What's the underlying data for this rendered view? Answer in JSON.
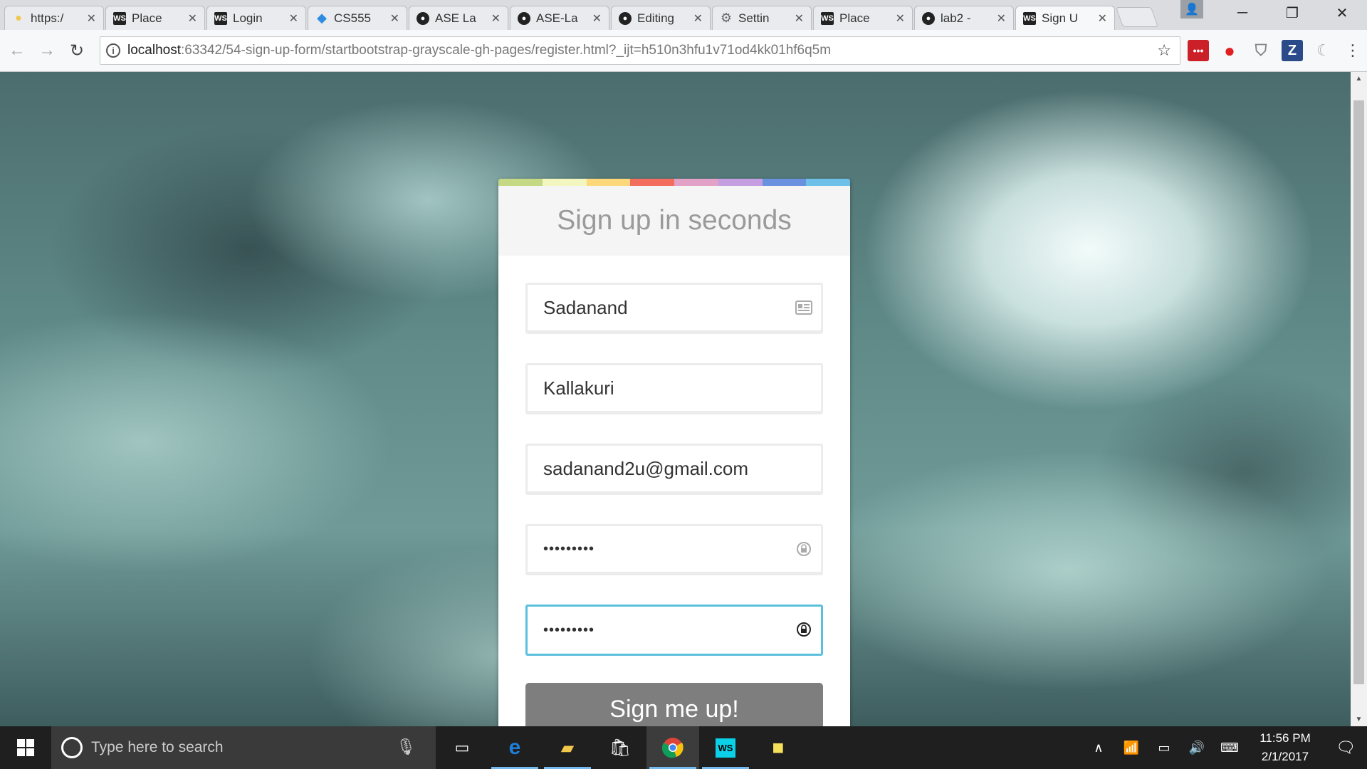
{
  "browser": {
    "tabs": [
      {
        "title": "https:/",
        "icon": "bulb-icon"
      },
      {
        "title": "Place",
        "icon": "webstorm-icon"
      },
      {
        "title": "Login",
        "icon": "webstorm-icon"
      },
      {
        "title": "CS555",
        "icon": "dropbox-icon"
      },
      {
        "title": "ASE La",
        "icon": "github-icon"
      },
      {
        "title": "ASE-La",
        "icon": "github-icon"
      },
      {
        "title": "Editing",
        "icon": "github-icon"
      },
      {
        "title": "Settin",
        "icon": "gear-icon"
      },
      {
        "title": "Place",
        "icon": "webstorm-icon"
      },
      {
        "title": "lab2 -",
        "icon": "github-icon"
      },
      {
        "title": "Sign U",
        "icon": "webstorm-icon"
      }
    ],
    "url_host": "localhost",
    "url_path": ":63342/54-sign-up-form/startbootstrap-grayscale-gh-pages/register.html?_ijt=h510n3hfu1v71od4kk01hf6q5m",
    "extensions": [
      "lastpass-icon",
      "opera-icon",
      "shield-icon",
      "zotero-icon",
      "moon-icon"
    ]
  },
  "form": {
    "header": "Sign up in seconds",
    "first_name": "Sadanand",
    "last_name": "Kallakuri",
    "email": "sadanand2u@gmail.com",
    "password": "•••••••••",
    "confirm_password": "•••••••••",
    "submit_label": "Sign me up!",
    "stripe_colors": [
      "#c5d883",
      "#f4f6c0",
      "#fcd87a",
      "#f26d5e",
      "#e2a1c6",
      "#c49ee0",
      "#6a91e0",
      "#6ec0e8"
    ],
    "focus_color": "#5bc0de",
    "button_color": "#7e7e7e",
    "button_accent": "#e8a317"
  },
  "taskbar": {
    "search_placeholder": "Type here to search",
    "time": "11:56 PM",
    "date": "2/1/2017",
    "apps": [
      "task-view-icon",
      "edge-icon",
      "file-explorer-icon",
      "store-icon",
      "chrome-icon",
      "webstorm-icon",
      "sticky-notes-icon"
    ]
  }
}
